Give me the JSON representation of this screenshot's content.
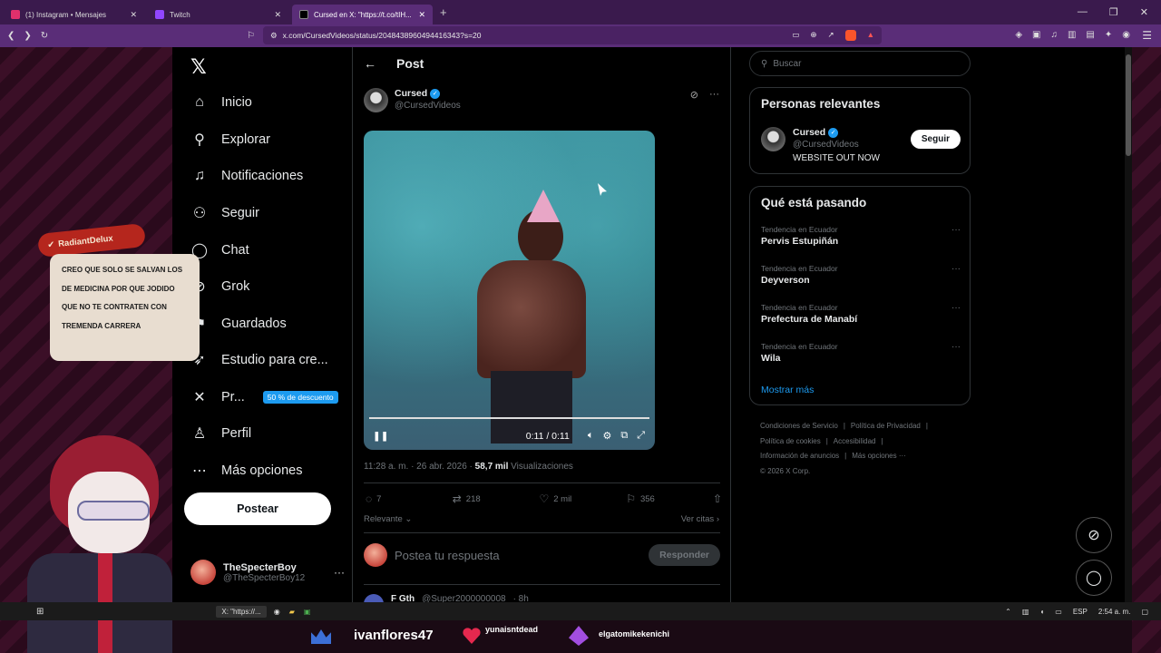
{
  "browser": {
    "tabs": [
      {
        "label": "(1) Instagram • Mensajes",
        "color": "#e1306c"
      },
      {
        "label": "Twitch",
        "color": "#9146ff"
      },
      {
        "label": "Cursed en X: \"https://t.co/tIH...",
        "color": "#000000",
        "active": true
      }
    ],
    "new_tab": "+",
    "url": "x.com/CursedVideos/status/2048438960494416343?s=20"
  },
  "nav": {
    "items": [
      {
        "label": "Inicio",
        "icon": "home-icon"
      },
      {
        "label": "Explorar",
        "icon": "search-icon"
      },
      {
        "label": "Notificaciones",
        "icon": "bell-icon"
      },
      {
        "label": "Seguir",
        "icon": "follow-icon"
      },
      {
        "label": "Chat",
        "icon": "chat-icon"
      },
      {
        "label": "Grok",
        "icon": "grok-icon"
      },
      {
        "label": "Guardados",
        "icon": "bookmark-icon"
      },
      {
        "label": "Estudio para cre...",
        "icon": "rocket-icon"
      },
      {
        "label": "Pr...",
        "icon": "x-icon"
      },
      {
        "label": "Perfil",
        "icon": "person-icon"
      },
      {
        "label": "Más opciones",
        "icon": "more-icon"
      }
    ],
    "premium_badge": "50 % de descuento",
    "post_button": "Postear",
    "account": {
      "name": "TheSpecterBoy",
      "handle": "@TheSpecterBoy12"
    }
  },
  "post": {
    "header_title": "Post",
    "author": {
      "name": "Cursed",
      "handle": "@CursedVideos"
    },
    "video": {
      "time": "0:11 / 0:11"
    },
    "timestamp": "11:28 a. m. · 26 abr. 2026 ·",
    "views_count": "58,7 mil",
    "views_label": "Visualizaciones",
    "stats": {
      "replies": "7",
      "reposts": "218",
      "likes": "2 mil",
      "bookmarks": "356"
    },
    "sort_label": "Relevante",
    "quotes_label": "Ver citas",
    "reply_placeholder": "Postea tu respuesta",
    "reply_button": "Responder",
    "next_post": {
      "name": "F Gth",
      "handle": "@Super2000000008",
      "time": "· 8h"
    }
  },
  "sidebar_right": {
    "search_placeholder": "Buscar",
    "relevant": {
      "title": "Personas relevantes",
      "name": "Cursed",
      "handle": "@CursedVideos",
      "bio": "WEBSITE OUT NOW",
      "follow_label": "Seguir"
    },
    "trending": {
      "title": "Qué está pasando",
      "items": [
        {
          "context": "Tendencia en Ecuador",
          "name": "Pervis Estupiñán"
        },
        {
          "context": "Tendencia en Ecuador",
          "name": "Deyverson"
        },
        {
          "context": "Tendencia en Ecuador",
          "name": "Prefectura de Manabí"
        },
        {
          "context": "Tendencia en Ecuador",
          "name": "Wila"
        }
      ],
      "show_more": "Mostrar más"
    },
    "footer": {
      "line1": [
        "Condiciones de Servicio",
        "|",
        "Política de Privacidad",
        "|"
      ],
      "line2": [
        "Política de cookies",
        "|",
        "Accesibilidad",
        "|"
      ],
      "line3": [
        "Información de anuncios",
        "|",
        "Más opciones ···"
      ],
      "copyright": "© 2026 X Corp."
    }
  },
  "overlay": {
    "chat_user": "RadiantDelux",
    "chat_message": "CREO QUE SOLO SE SALVAN LOS DE MEDICINA POR QUE JODIDO QUE NO TE CONTRATEN CON TREMENDA CARRERA",
    "stream_names": [
      "ivanflores47",
      "yunaisntdead",
      "elgatomikekenichi"
    ]
  },
  "taskbar": {
    "app_label": "X: \"https://...",
    "lang": "ESP",
    "clock": "2:54 a. m."
  }
}
